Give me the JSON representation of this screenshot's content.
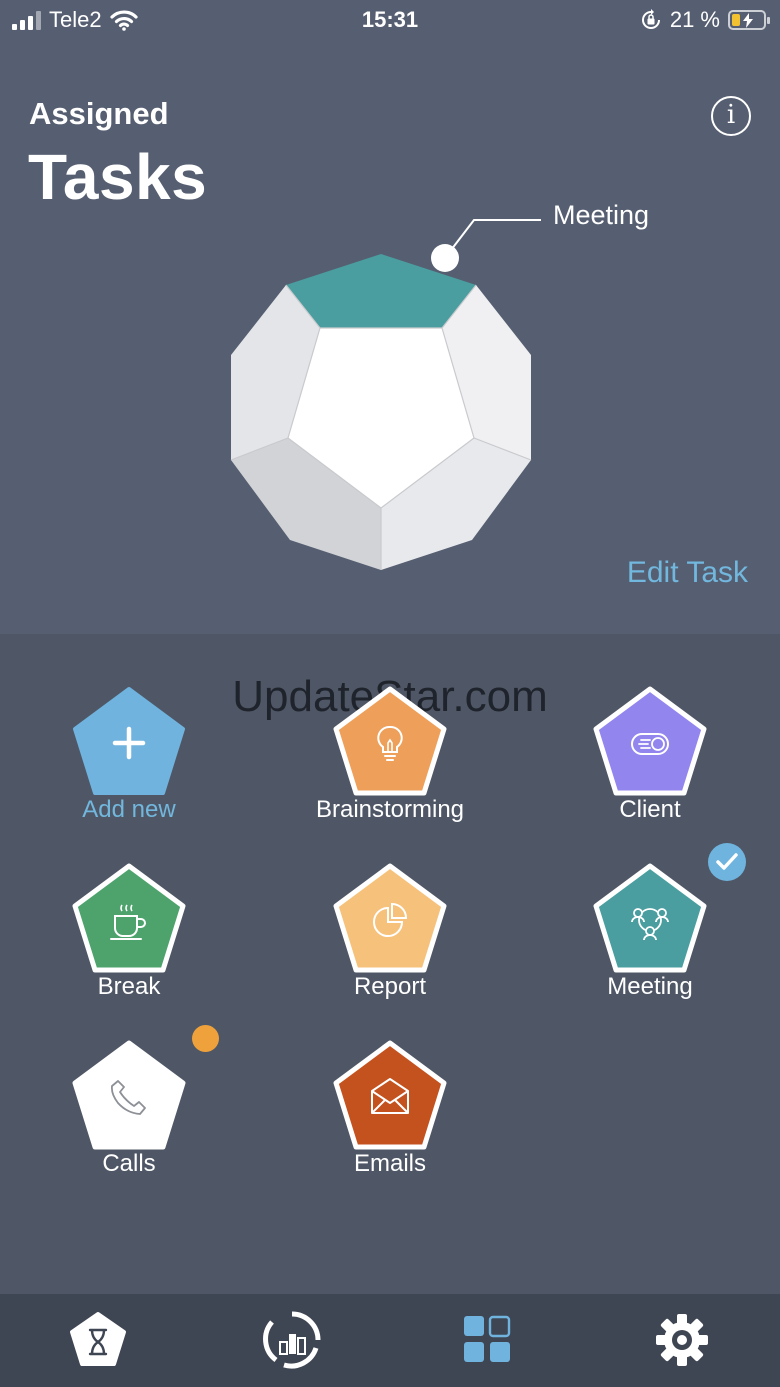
{
  "status_bar": {
    "carrier": "Tele2",
    "time": "15:31",
    "battery": "21 %"
  },
  "header": {
    "subtitle": "Assigned",
    "title": "Tasks",
    "info_glyph": "i",
    "info_icon": "info-icon"
  },
  "polyhedron": {
    "callout_label": "Meeting",
    "highlight_color": "#4a9ea0"
  },
  "edit_task": "Edit Task",
  "watermark": "UpdateStar.com",
  "tasks": [
    {
      "label": "Add new",
      "color": "#6fb3de",
      "icon": "plus-icon"
    },
    {
      "label": "Brainstorming",
      "color": "#eea05a",
      "icon": "lightbulb-icon"
    },
    {
      "label": "Client",
      "color": "#9285ee",
      "icon": "client-icon"
    },
    {
      "label": "Break",
      "color": "#4ea36d",
      "icon": "coffee-cup-icon"
    },
    {
      "label": "Report",
      "color": "#f6c27b",
      "icon": "pie-chart-icon"
    },
    {
      "label": "Meeting",
      "color": "#4a9ea0",
      "icon": "people-network-icon",
      "selected": true
    },
    {
      "label": "Calls",
      "color": "#ffffff",
      "icon": "phone-icon",
      "notification": true
    },
    {
      "label": "Emails",
      "color": "#c4521f",
      "icon": "envelope-icon"
    }
  ],
  "tab_bar": [
    {
      "icon": "hourglass-icon"
    },
    {
      "icon": "statistics-icon"
    },
    {
      "icon": "grid-icon",
      "active": true
    },
    {
      "icon": "gear-icon"
    }
  ],
  "colors": {
    "top_background": "#565f71",
    "grid_background": "#4f5766",
    "tab_bar_background": "#3f4653",
    "accent_blue": "#72b7dd",
    "notification_orange": "#efa13b"
  }
}
